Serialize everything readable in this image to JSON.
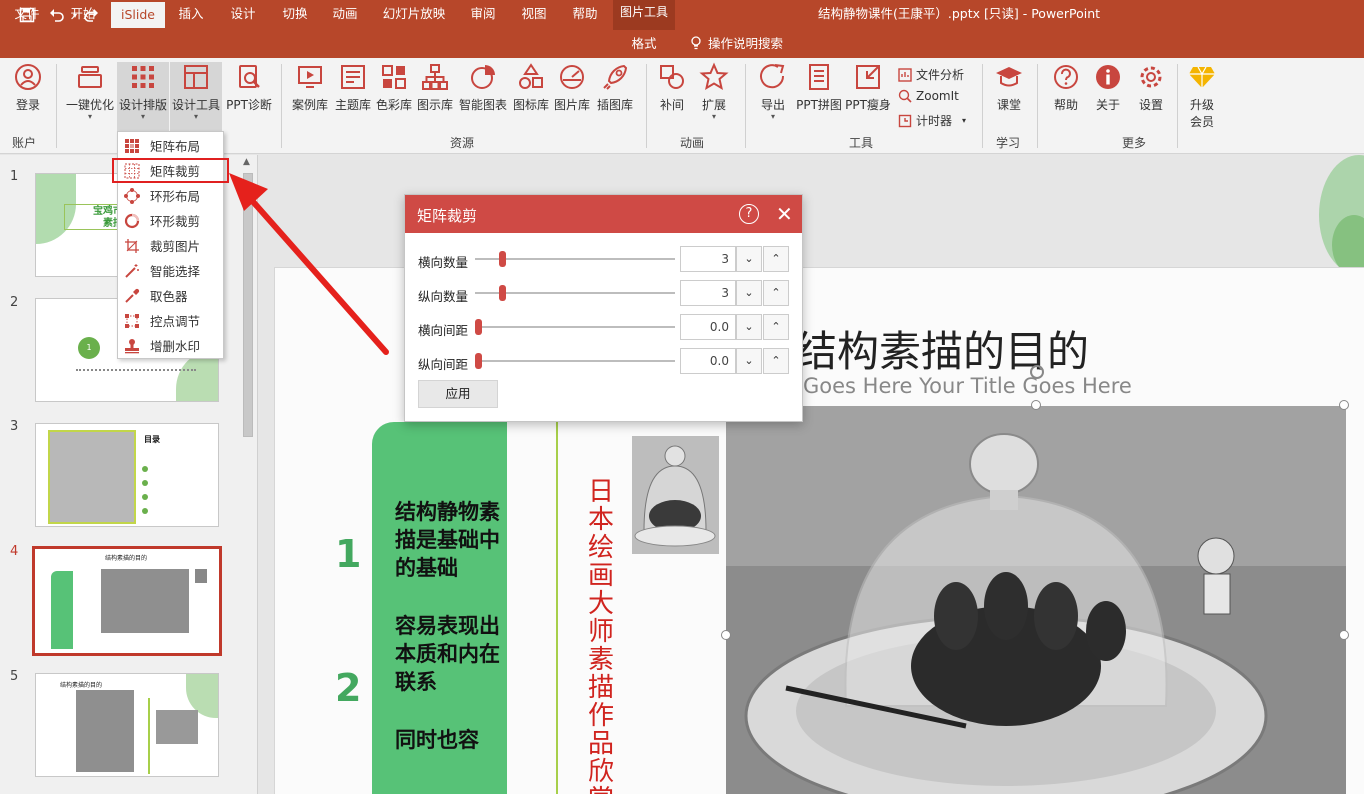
{
  "app": {
    "doc_title": "结构静物课件(王康平）.pptx [只读]  -  PowerPoint",
    "context_tool": "图片工具",
    "accent": "#b7472a"
  },
  "tabs": [
    {
      "label": "文件"
    },
    {
      "label": "开始"
    },
    {
      "label": "iSlide",
      "active": true
    },
    {
      "label": "插入"
    },
    {
      "label": "设计"
    },
    {
      "label": "切换"
    },
    {
      "label": "动画"
    },
    {
      "label": "幻灯片放映"
    },
    {
      "label": "审阅"
    },
    {
      "label": "视图"
    },
    {
      "label": "帮助"
    },
    {
      "label": "格式"
    }
  ],
  "search_label": "操作说明搜索",
  "ribbon": {
    "login": "登录",
    "optimize": "一键优化",
    "layout": "设计排版",
    "tools": "设计工具",
    "diagnose": "PPT诊断",
    "cases": "案例库",
    "themes": "主题库",
    "colors": "色彩库",
    "diagrams": "图示库",
    "smart_chart": "智能图表",
    "icons": "图标库",
    "pictures": "图片库",
    "illustrations": "插图库",
    "tween": "补间",
    "extend": "扩展",
    "export": "导出",
    "ppt_merge": "PPT拼图",
    "ppt_slim": "PPT瘦身",
    "file_analysis": "文件分析",
    "zoomit": "ZoomIt",
    "timer": "计时器",
    "course": "课堂",
    "help": "帮助",
    "about": "关于",
    "settings": "设置",
    "upgrade_l1": "升级",
    "upgrade_l2": "会员",
    "groups": {
      "account": "账户",
      "resources": "资源",
      "animation": "动画",
      "tools": "工具",
      "learn": "学习",
      "more": "更多"
    }
  },
  "dropdown": [
    {
      "label": "矩阵布局",
      "icon": "matrix-layout-icon"
    },
    {
      "label": "矩阵裁剪",
      "icon": "matrix-crop-icon",
      "highlight": true
    },
    {
      "label": "环形布局",
      "icon": "ring-layout-icon"
    },
    {
      "label": "环形裁剪",
      "icon": "ring-crop-icon"
    },
    {
      "label": "裁剪图片",
      "icon": "crop-image-icon"
    },
    {
      "label": "智能选择",
      "icon": "magic-wand-icon"
    },
    {
      "label": "取色器",
      "icon": "eyedropper-icon"
    },
    {
      "label": "控点调节",
      "icon": "handle-adjust-icon"
    },
    {
      "label": "增删水印",
      "icon": "watermark-icon"
    }
  ],
  "slides": [
    {
      "num": "1"
    },
    {
      "num": "2"
    },
    {
      "num": "3"
    },
    {
      "num": "4",
      "active": true
    },
    {
      "num": "5"
    }
  ],
  "slide_texts": {
    "s1_title_l1": "宝鸡市委",
    "s1_title_l2": "素描",
    "s3_heading": "目录",
    "s4_title": "结构素描的目的",
    "s5_title": "结构素描的目的",
    "s2_circle": "1"
  },
  "dialog": {
    "title": "矩阵裁剪",
    "help": "?",
    "rows": [
      {
        "label": "横向数量",
        "value": "3",
        "level": 0.12
      },
      {
        "label": "纵向数量",
        "value": "3",
        "level": 0.12
      },
      {
        "label": "横向间距",
        "value": "0.0",
        "level": 0.0
      },
      {
        "label": "纵向间距",
        "value": "0.0",
        "level": 0.0
      }
    ],
    "apply": "应用"
  },
  "slide": {
    "title": "结构素描的目的",
    "subtitle": "Goes Here Your Title Goes Here",
    "num1": "1",
    "num2": "2",
    "green_text": "结构静物素描是基础中的基础",
    "green_text2": "容易表现出本质和内在联系",
    "green_text3": "同时也容",
    "vertical_text": "日本绘画大师素描作品欣赏"
  }
}
